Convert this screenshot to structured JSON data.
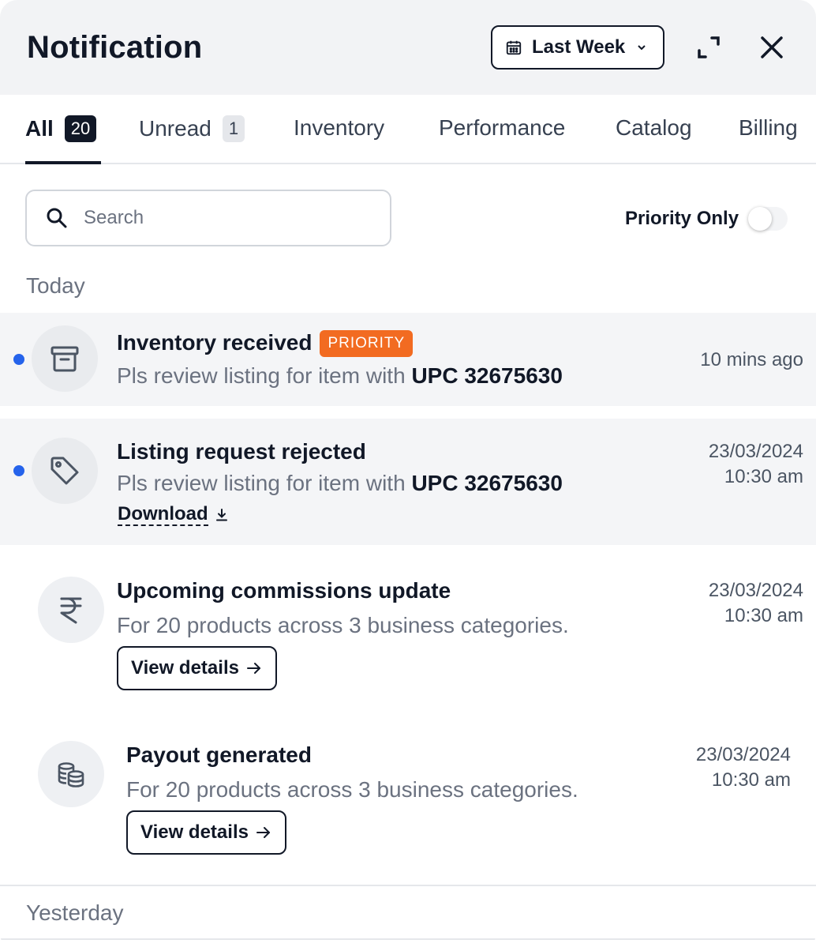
{
  "header": {
    "title": "Notification",
    "date_filter": "Last Week"
  },
  "tabs": [
    {
      "label": "All",
      "count": "20"
    },
    {
      "label": "Unread",
      "count": "1"
    },
    {
      "label": "Inventory"
    },
    {
      "label": "Performance"
    },
    {
      "label": "Catalog"
    },
    {
      "label": "Billing"
    }
  ],
  "search": {
    "placeholder": "Search"
  },
  "priority_toggle": {
    "label": "Priority Only",
    "on": false
  },
  "sections": [
    {
      "label": "Today",
      "items": [
        {
          "icon": "archive-box-icon",
          "title": "Inventory received",
          "badge": "PRIORITY",
          "text_prefix": "Pls review listing for item with ",
          "text_bold": "UPC 32675630",
          "time": "10 mins ago",
          "unread": true
        },
        {
          "icon": "tag-icon",
          "title": "Listing request rejected",
          "text_prefix": "Pls review listing for item with ",
          "text_bold": "UPC 32675630",
          "date": "23/03/2024",
          "time": "10:30 am",
          "action": "Download",
          "unread": true
        },
        {
          "icon": "rupee-icon",
          "title": "Upcoming commissions update",
          "text": "For 20 products across 3 business categories.",
          "date": "23/03/2024",
          "time": "10:30 am",
          "action": "View details",
          "unread": false
        },
        {
          "icon": "coins-stack-icon",
          "title": "Payout generated",
          "text": "For 20 products across 3 business categories.",
          "date": "23/03/2024",
          "time": "10:30 am",
          "action": "View details",
          "unread": false
        }
      ]
    },
    {
      "label": "Yesterday",
      "items": []
    }
  ],
  "colors": {
    "accent_dark": "#111827",
    "priority_badge": "#f26b21",
    "unread_dot": "#2563eb",
    "unread_bg": "#f4f5f7",
    "header_bg": "#f2f3f5"
  }
}
